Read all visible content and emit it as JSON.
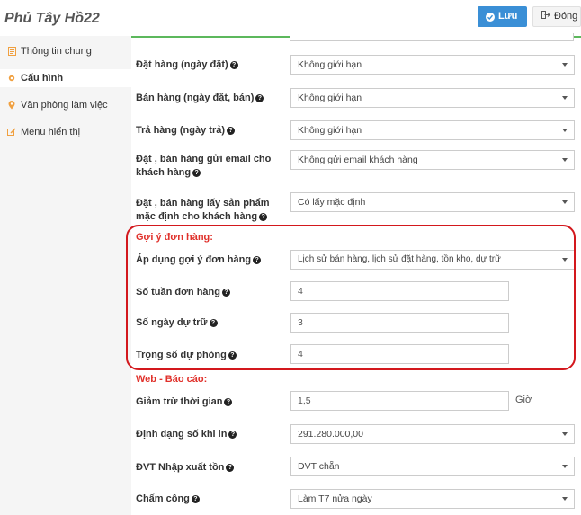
{
  "header": {
    "title": "Phủ Tây Hồ22",
    "save_label": "Lưu",
    "close_label": "Đóng"
  },
  "sidebar": {
    "items": [
      {
        "label": "Thông tin chung",
        "icon": "document-icon",
        "active": false
      },
      {
        "label": "Cấu hình",
        "icon": "gear-icon",
        "active": true
      },
      {
        "label": "Văn phòng làm việc",
        "icon": "map-marker-icon",
        "active": false
      },
      {
        "label": "Menu hiển thị",
        "icon": "edit-icon",
        "active": false
      }
    ]
  },
  "form": {
    "rows": [
      {
        "label": "Đặt hàng (ngày đặt)",
        "value": "Không giới hạn"
      },
      {
        "label": "Bán hàng (ngày đặt, bán)",
        "value": "Không giới hạn"
      },
      {
        "label": "Trả hàng (ngày trả)",
        "value": "Không giới hạn"
      },
      {
        "label": "Đặt , bán hàng gửi email cho khách hàng",
        "value": "Không gửi email khách hàng"
      },
      {
        "label": "Đặt , bán hàng lấy sản phẩm mặc định cho khách hàng",
        "value": "Có lấy mặc định"
      }
    ],
    "order_suggestion": {
      "heading": "Gợi ý đơn hàng:",
      "apply_label": "Áp dụng gợi ý đơn hàng",
      "apply_value": "Lịch sử bán hàng, lịch sử đặt hàng, tồn kho, dự trữ",
      "weeks_label": "Số tuần đơn hàng",
      "weeks_value": "4",
      "reserve_days_label": "Số ngày dự trữ",
      "reserve_days_value": "3",
      "backup_weight_label": "Trọng số dự phòng",
      "backup_weight_value": "4"
    },
    "web_report": {
      "heading": "Web - Báo cáo:",
      "time_label": "Giảm trừ thời gian",
      "time_value": "1,5",
      "time_unit": "Giờ",
      "number_format_label": "Định dạng số khi in",
      "number_format_value": "291.280.000,00",
      "unit_label": "ĐVT Nhập xuất tồn",
      "unit_value": "ĐVT chẵn",
      "attendance_label": "Chấm công",
      "attendance_value": "Làm T7 nửa ngày"
    }
  },
  "colors": {
    "accent": "#3a8fd6",
    "section_heading": "#e0312b",
    "highlight_border": "#d3181d",
    "top_line": "#5cb85c"
  }
}
